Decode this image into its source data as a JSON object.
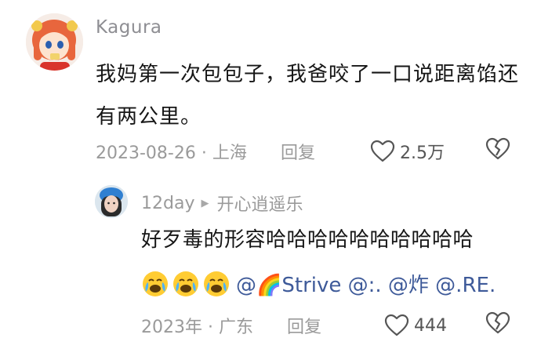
{
  "comment": {
    "username": "Kagura",
    "content": "我妈第一次包包子，我爸咬了一口说距离馅还有两公里。",
    "date_location": "2023-08-26 · 上海",
    "reply_label": "回复",
    "like_count": "2.5万",
    "icons": {
      "avatar": "anime-girl-avatar",
      "like": "heart-outline-icon",
      "dislike": "broken-heart-icon"
    }
  },
  "reply": {
    "username": "12day",
    "reply_to": "开心逍遥乐",
    "text_line1": "好歹毒的形容哈哈哈哈哈哈哈哈哈哈",
    "mentions": "@🌈Strive @:. @炸 @.RE.",
    "emoji_count": 3,
    "date_location": "2023年 · 广东",
    "reply_label": "回复",
    "like_count": "444",
    "icons": {
      "avatar": "girl-blue-hat-avatar",
      "reply_arrow": "play-triangle-icon",
      "emoji": "crying-laughing-face-icon",
      "rainbow": "rainbow-icon",
      "like": "heart-outline-icon",
      "dislike": "broken-heart-icon"
    }
  }
}
